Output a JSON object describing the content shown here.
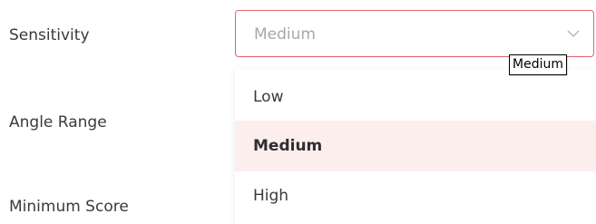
{
  "form": {
    "labels": {
      "sensitivity": "Sensitivity",
      "angle_range": "Angle Range",
      "minimum_score": "Minimum Score"
    }
  },
  "sensitivity_select": {
    "value": "Medium",
    "icon": "chevron-down-icon",
    "tooltip": "Medium",
    "border_color": "#e5606a"
  },
  "dropdown": {
    "options": [
      {
        "label": "Low",
        "selected": false
      },
      {
        "label": "Medium",
        "selected": true
      },
      {
        "label": "High",
        "selected": false
      }
    ],
    "selected_background": "#fdeeee"
  }
}
